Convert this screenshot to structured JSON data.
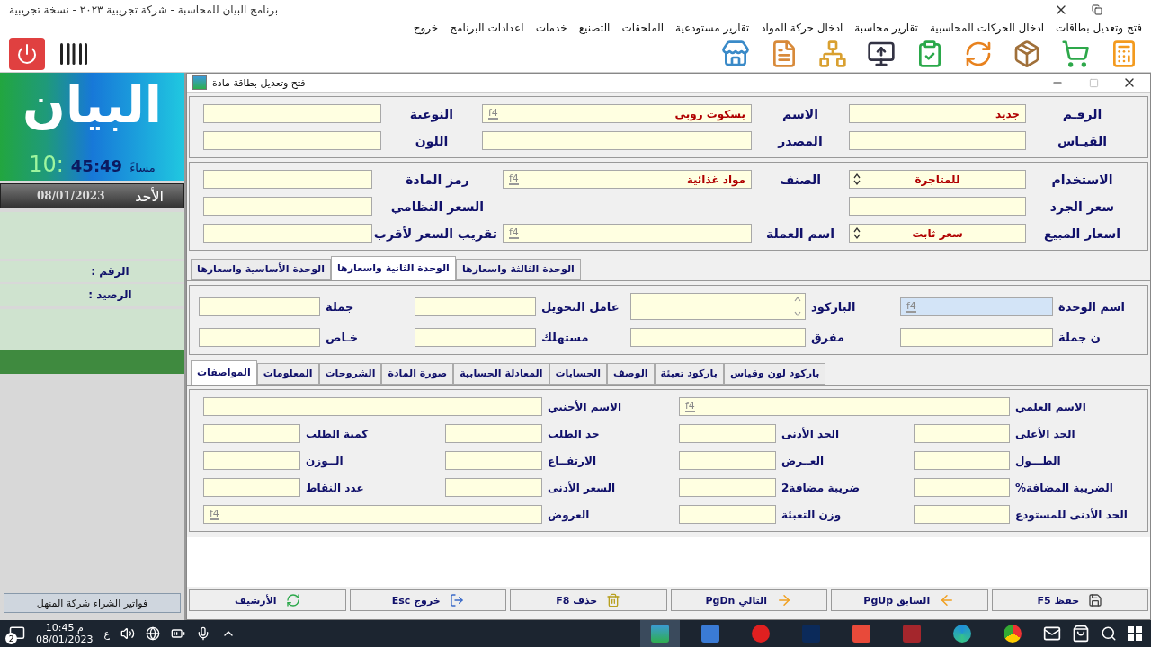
{
  "app_title": "برنامج البيان للمحاسبة  -  شركة تجريبية ٢٠٢٣ - نسخة تجريبية",
  "menu": [
    "فتح وتعديل بطاقات",
    "ادخال الحركات المحاسبية",
    "تقارير محاسبة",
    "ادخال حركة المواد",
    "تقارير مستودعية",
    "الملحقات",
    "التصنيع",
    "خدمات",
    "اعدادات البرنامج",
    "خروج"
  ],
  "sidebar": {
    "logo": "البيان",
    "clock": {
      "hour": "10:",
      "time": "45:49",
      "period": "مساءً"
    },
    "day": "الأحد",
    "date": "08/01/2023",
    "fields": [
      "الرقم :",
      "الرصيد :"
    ],
    "status": "فواتير الشراء شركة المنهل"
  },
  "card_window": {
    "title": "فتح وتعديل بطاقة مادة",
    "main_rows": [
      [
        {
          "label": "الرقـم",
          "value": "جديد"
        },
        {
          "label": "الاسم",
          "value": "بسكوت روبي",
          "lookup": "f4"
        },
        {
          "label": "النوعية"
        }
      ],
      [
        {
          "label": "القيـاس"
        },
        {
          "label": "المصدر"
        },
        {
          "label": "اللون"
        }
      ]
    ],
    "class_rows": [
      [
        {
          "label": "الاستخدام",
          "value": "للمتاجرة",
          "kind": "spin"
        },
        {
          "label": "الصنف",
          "value": "مواد غذائية",
          "lookup": "f4"
        },
        {
          "label": "رمز المادة"
        }
      ],
      [
        {
          "label": "سعر الجرد"
        },
        {
          "label": "السعر النظامي"
        }
      ],
      [
        {
          "label": "اسعار المبيع",
          "value": "سعر ثابت",
          "kind": "spin"
        },
        {
          "label": "اسم العملة",
          "lookup": "f4"
        },
        {
          "label": "تقريب السعر لأقرب"
        }
      ]
    ],
    "unit_tabs": [
      {
        "label": "الوحدة الثالثة واسعارها",
        "selected": false
      },
      {
        "label": "الوحدة الثانية واسعارها",
        "selected": true
      },
      {
        "label": "الوحدة الأساسية واسعارها",
        "selected": false
      }
    ],
    "unit_rows": [
      [
        {
          "label": "اسم الوحدة",
          "lookup": "f4",
          "focused": true
        },
        {
          "label": "الباركود",
          "kind": "memo",
          "focused": false
        },
        {
          "label": "عامل التحويل",
          "focused": false
        },
        {
          "label": "جملة",
          "focused": false
        }
      ],
      [
        {
          "label": "ن جملة",
          "focused": false
        },
        {
          "label": "مفرق",
          "focused": false
        },
        {
          "label": "مستهلك",
          "focused": false
        },
        {
          "label": "خـاص",
          "focused": false
        }
      ]
    ],
    "detail_tabs": [
      {
        "label": "باركود لون وقياس",
        "selected": false
      },
      {
        "label": "باركود تعبئة",
        "selected": false
      },
      {
        "label": "الوصف",
        "selected": false
      },
      {
        "label": "الحسابات",
        "selected": false
      },
      {
        "label": "المعادلة الحسابية",
        "selected": false
      },
      {
        "label": "صورة المادة",
        "selected": false
      },
      {
        "label": "الشروحات",
        "selected": false
      },
      {
        "label": "المعلومات",
        "selected": false
      },
      {
        "label": "المواصفات",
        "selected": true
      }
    ],
    "spec_rows": [
      [
        {
          "label": "الاسم العلمي",
          "lookup": "f4"
        },
        {
          "label": "الاسم الأجنبي"
        }
      ],
      [
        {
          "label": "الحد الأعلى"
        },
        {
          "label": "الحد الأدنى"
        },
        {
          "label": "حد الطلب"
        },
        {
          "label": "كمية الطلب"
        }
      ],
      [
        {
          "label": "الطـــول"
        },
        {
          "label": "العــرض"
        },
        {
          "label": "الارتفــاع"
        },
        {
          "label": "الــوزن"
        }
      ],
      [
        {
          "label": "الضريبة المضافة%"
        },
        {
          "label": "ضريبة مضافة2"
        },
        {
          "label": "السعر الأدنى"
        },
        {
          "label": "عدد النقاط"
        }
      ],
      [
        {
          "label": "الحد الأدنى للمستودع"
        },
        {
          "label": "وزن التعبئة"
        },
        {
          "label": "العروض",
          "lookup": "f4"
        }
      ]
    ],
    "buttons": [
      "حفظ F5",
      "السابق PgUp",
      "التالي PgDn",
      "حذف F8",
      "خروج Esc",
      "الأرشيف"
    ]
  },
  "taskbar": {
    "notifications": "2",
    "time": "10:45 م",
    "date": "08/01/2023",
    "input_language": "ع"
  }
}
